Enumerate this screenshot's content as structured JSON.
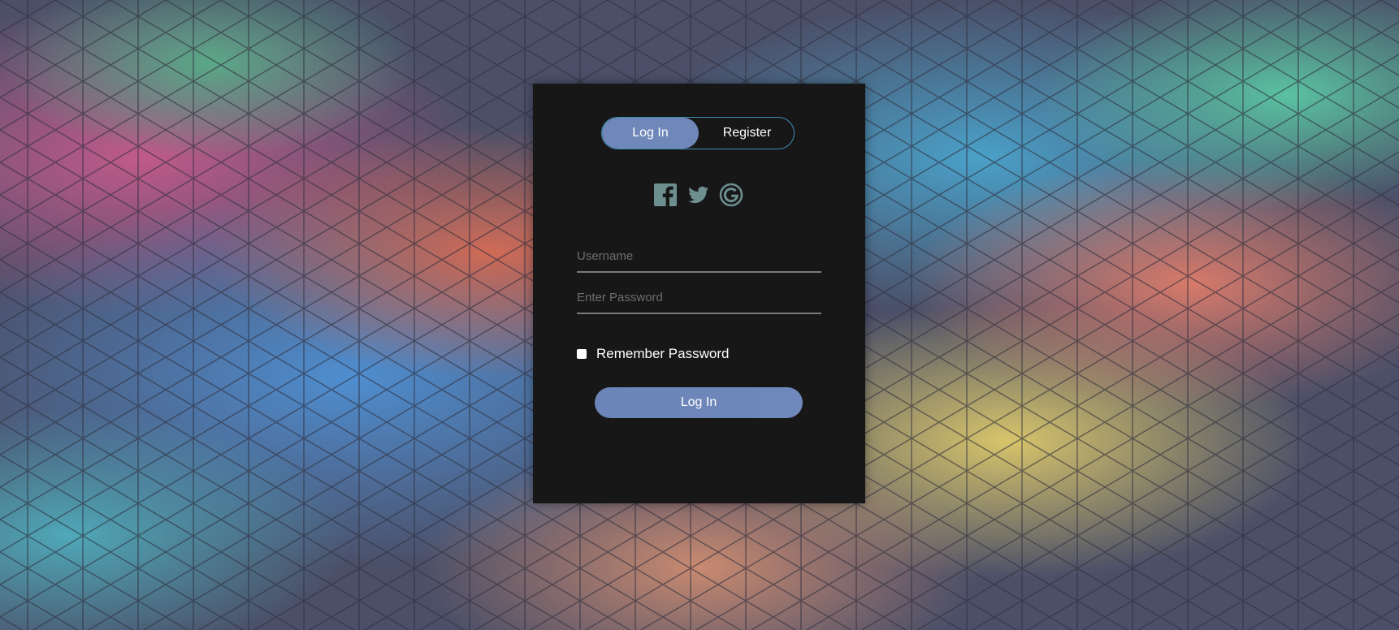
{
  "tabs": {
    "login_label": "Log In",
    "register_label": "Register",
    "active": "login"
  },
  "social": {
    "icons": [
      "facebook-icon",
      "twitter-icon",
      "google-icon"
    ],
    "icon_color": "#6d8f8f"
  },
  "form": {
    "username_placeholder": "Username",
    "username_value": "",
    "password_placeholder": "Enter Password",
    "password_value": "",
    "remember_label": "Remember Password",
    "remember_checked": false,
    "submit_label": "Log In"
  },
  "colors": {
    "card_background": "#171717",
    "accent": "#6f87b9",
    "tab_border": "#3f8fb3"
  }
}
